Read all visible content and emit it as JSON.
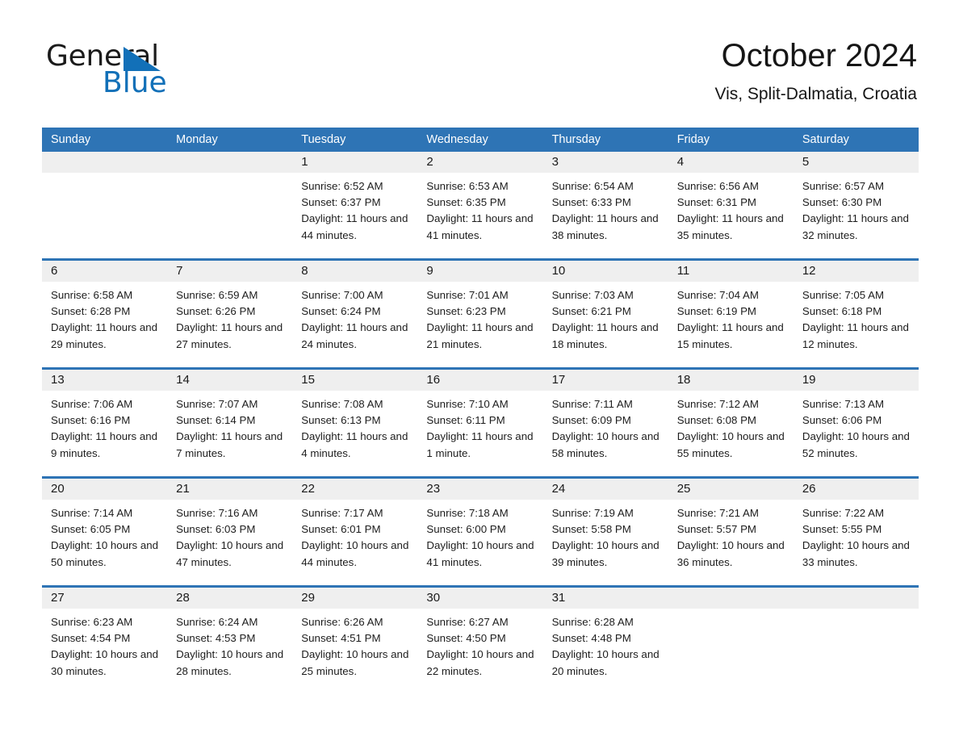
{
  "brand": {
    "name_part1": "General",
    "name_part2": "Blue",
    "triangle_icon": "triangle-icon",
    "accent_color": "#1270b8"
  },
  "header": {
    "title": "October 2024",
    "subtitle": "Vis, Split-Dalmatia, Croatia"
  },
  "calendar": {
    "header_color": "#2e74b5",
    "day_strip_color": "#efefef",
    "weekdays": [
      "Sunday",
      "Monday",
      "Tuesday",
      "Wednesday",
      "Thursday",
      "Friday",
      "Saturday"
    ],
    "weeks": [
      [
        {
          "date": "",
          "empty": true,
          "sunrise": "",
          "sunset": "",
          "daylight": ""
        },
        {
          "date": "",
          "empty": true,
          "sunrise": "",
          "sunset": "",
          "daylight": ""
        },
        {
          "date": "1",
          "empty": false,
          "sunrise": "Sunrise: 6:52 AM",
          "sunset": "Sunset: 6:37 PM",
          "daylight": "Daylight: 11 hours and 44 minutes."
        },
        {
          "date": "2",
          "empty": false,
          "sunrise": "Sunrise: 6:53 AM",
          "sunset": "Sunset: 6:35 PM",
          "daylight": "Daylight: 11 hours and 41 minutes."
        },
        {
          "date": "3",
          "empty": false,
          "sunrise": "Sunrise: 6:54 AM",
          "sunset": "Sunset: 6:33 PM",
          "daylight": "Daylight: 11 hours and 38 minutes."
        },
        {
          "date": "4",
          "empty": false,
          "sunrise": "Sunrise: 6:56 AM",
          "sunset": "Sunset: 6:31 PM",
          "daylight": "Daylight: 11 hours and 35 minutes."
        },
        {
          "date": "5",
          "empty": false,
          "sunrise": "Sunrise: 6:57 AM",
          "sunset": "Sunset: 6:30 PM",
          "daylight": "Daylight: 11 hours and 32 minutes."
        }
      ],
      [
        {
          "date": "6",
          "empty": false,
          "sunrise": "Sunrise: 6:58 AM",
          "sunset": "Sunset: 6:28 PM",
          "daylight": "Daylight: 11 hours and 29 minutes."
        },
        {
          "date": "7",
          "empty": false,
          "sunrise": "Sunrise: 6:59 AM",
          "sunset": "Sunset: 6:26 PM",
          "daylight": "Daylight: 11 hours and 27 minutes."
        },
        {
          "date": "8",
          "empty": false,
          "sunrise": "Sunrise: 7:00 AM",
          "sunset": "Sunset: 6:24 PM",
          "daylight": "Daylight: 11 hours and 24 minutes."
        },
        {
          "date": "9",
          "empty": false,
          "sunrise": "Sunrise: 7:01 AM",
          "sunset": "Sunset: 6:23 PM",
          "daylight": "Daylight: 11 hours and 21 minutes."
        },
        {
          "date": "10",
          "empty": false,
          "sunrise": "Sunrise: 7:03 AM",
          "sunset": "Sunset: 6:21 PM",
          "daylight": "Daylight: 11 hours and 18 minutes."
        },
        {
          "date": "11",
          "empty": false,
          "sunrise": "Sunrise: 7:04 AM",
          "sunset": "Sunset: 6:19 PM",
          "daylight": "Daylight: 11 hours and 15 minutes."
        },
        {
          "date": "12",
          "empty": false,
          "sunrise": "Sunrise: 7:05 AM",
          "sunset": "Sunset: 6:18 PM",
          "daylight": "Daylight: 11 hours and 12 minutes."
        }
      ],
      [
        {
          "date": "13",
          "empty": false,
          "sunrise": "Sunrise: 7:06 AM",
          "sunset": "Sunset: 6:16 PM",
          "daylight": "Daylight: 11 hours and 9 minutes."
        },
        {
          "date": "14",
          "empty": false,
          "sunrise": "Sunrise: 7:07 AM",
          "sunset": "Sunset: 6:14 PM",
          "daylight": "Daylight: 11 hours and 7 minutes."
        },
        {
          "date": "15",
          "empty": false,
          "sunrise": "Sunrise: 7:08 AM",
          "sunset": "Sunset: 6:13 PM",
          "daylight": "Daylight: 11 hours and 4 minutes."
        },
        {
          "date": "16",
          "empty": false,
          "sunrise": "Sunrise: 7:10 AM",
          "sunset": "Sunset: 6:11 PM",
          "daylight": "Daylight: 11 hours and 1 minute."
        },
        {
          "date": "17",
          "empty": false,
          "sunrise": "Sunrise: 7:11 AM",
          "sunset": "Sunset: 6:09 PM",
          "daylight": "Daylight: 10 hours and 58 minutes."
        },
        {
          "date": "18",
          "empty": false,
          "sunrise": "Sunrise: 7:12 AM",
          "sunset": "Sunset: 6:08 PM",
          "daylight": "Daylight: 10 hours and 55 minutes."
        },
        {
          "date": "19",
          "empty": false,
          "sunrise": "Sunrise: 7:13 AM",
          "sunset": "Sunset: 6:06 PM",
          "daylight": "Daylight: 10 hours and 52 minutes."
        }
      ],
      [
        {
          "date": "20",
          "empty": false,
          "sunrise": "Sunrise: 7:14 AM",
          "sunset": "Sunset: 6:05 PM",
          "daylight": "Daylight: 10 hours and 50 minutes."
        },
        {
          "date": "21",
          "empty": false,
          "sunrise": "Sunrise: 7:16 AM",
          "sunset": "Sunset: 6:03 PM",
          "daylight": "Daylight: 10 hours and 47 minutes."
        },
        {
          "date": "22",
          "empty": false,
          "sunrise": "Sunrise: 7:17 AM",
          "sunset": "Sunset: 6:01 PM",
          "daylight": "Daylight: 10 hours and 44 minutes."
        },
        {
          "date": "23",
          "empty": false,
          "sunrise": "Sunrise: 7:18 AM",
          "sunset": "Sunset: 6:00 PM",
          "daylight": "Daylight: 10 hours and 41 minutes."
        },
        {
          "date": "24",
          "empty": false,
          "sunrise": "Sunrise: 7:19 AM",
          "sunset": "Sunset: 5:58 PM",
          "daylight": "Daylight: 10 hours and 39 minutes."
        },
        {
          "date": "25",
          "empty": false,
          "sunrise": "Sunrise: 7:21 AM",
          "sunset": "Sunset: 5:57 PM",
          "daylight": "Daylight: 10 hours and 36 minutes."
        },
        {
          "date": "26",
          "empty": false,
          "sunrise": "Sunrise: 7:22 AM",
          "sunset": "Sunset: 5:55 PM",
          "daylight": "Daylight: 10 hours and 33 minutes."
        }
      ],
      [
        {
          "date": "27",
          "empty": false,
          "sunrise": "Sunrise: 6:23 AM",
          "sunset": "Sunset: 4:54 PM",
          "daylight": "Daylight: 10 hours and 30 minutes."
        },
        {
          "date": "28",
          "empty": false,
          "sunrise": "Sunrise: 6:24 AM",
          "sunset": "Sunset: 4:53 PM",
          "daylight": "Daylight: 10 hours and 28 minutes."
        },
        {
          "date": "29",
          "empty": false,
          "sunrise": "Sunrise: 6:26 AM",
          "sunset": "Sunset: 4:51 PM",
          "daylight": "Daylight: 10 hours and 25 minutes."
        },
        {
          "date": "30",
          "empty": false,
          "sunrise": "Sunrise: 6:27 AM",
          "sunset": "Sunset: 4:50 PM",
          "daylight": "Daylight: 10 hours and 22 minutes."
        },
        {
          "date": "31",
          "empty": false,
          "sunrise": "Sunrise: 6:28 AM",
          "sunset": "Sunset: 4:48 PM",
          "daylight": "Daylight: 10 hours and 20 minutes."
        },
        {
          "date": "",
          "empty": true,
          "sunrise": "",
          "sunset": "",
          "daylight": ""
        },
        {
          "date": "",
          "empty": true,
          "sunrise": "",
          "sunset": "",
          "daylight": ""
        }
      ]
    ]
  }
}
